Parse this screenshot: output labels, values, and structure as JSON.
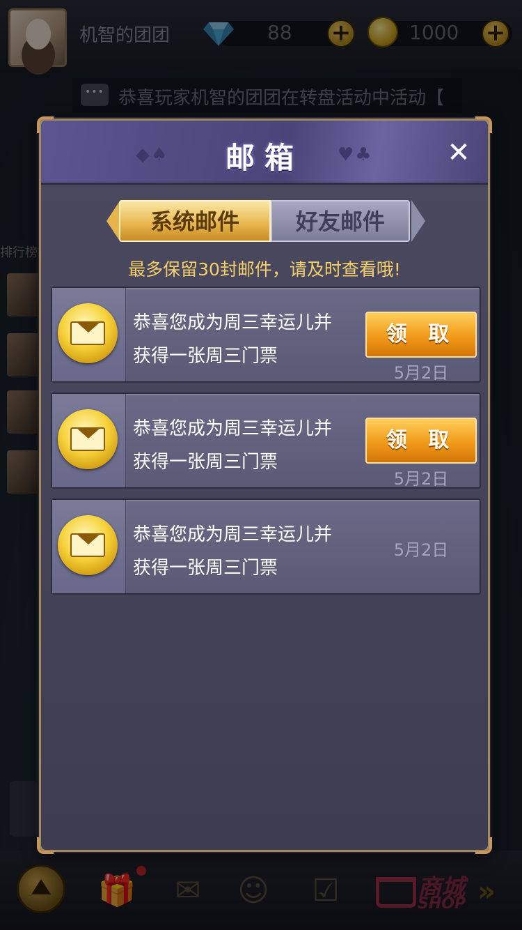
{
  "header": {
    "player_name": "机智的团团",
    "diamonds": "88",
    "coins": "1000"
  },
  "marquee": {
    "text": "恭喜玩家机智的团团在转盘活动中活动【"
  },
  "side": {
    "rank_label": "排行榜"
  },
  "shop": {
    "label_cn": "商城",
    "label_en": "SHOP"
  },
  "dialog": {
    "title": "邮箱",
    "tabs": [
      {
        "label": "系统邮件",
        "active": true
      },
      {
        "label": "好友邮件",
        "active": false
      }
    ],
    "notice": "最多保留30封邮件，请及时查看哦!",
    "mails": [
      {
        "line1": "恭喜您成为周三幸运儿并",
        "line2": "获得一张周三门票",
        "button": "领 取",
        "date": "5月2日"
      },
      {
        "line1": "恭喜您成为周三幸运儿并",
        "line2": "获得一张周三门票",
        "button": "领 取",
        "date": "5月2日"
      },
      {
        "line1": "恭喜您成为周三幸运儿并",
        "line2": "获得一张周三门票",
        "date": "5月2日"
      }
    ]
  },
  "icons": {
    "close": "close-icon",
    "mail": "envelope-icon",
    "diamond": "diamond-icon",
    "coin": "coin-icon"
  },
  "colors": {
    "accent_gold": "#f4cf6a",
    "claim_orange": "#f19a1a",
    "dialog_bg": "#4b4a60"
  }
}
